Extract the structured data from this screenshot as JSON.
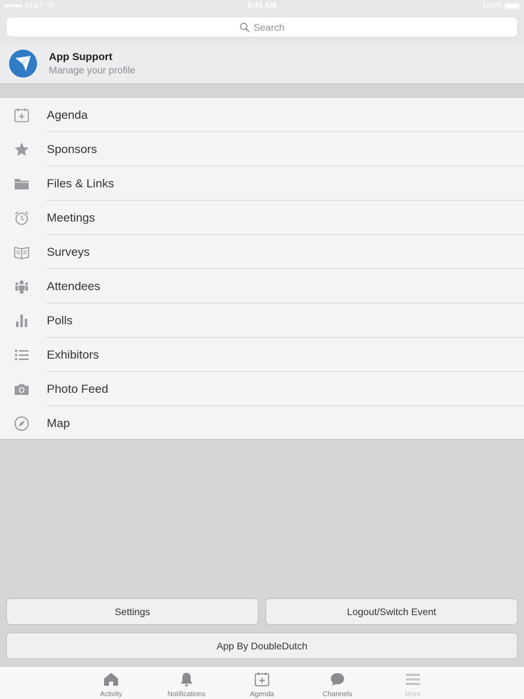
{
  "status_bar": {
    "carrier": "AT&T",
    "time": "9:41 AM",
    "battery": "100%"
  },
  "search": {
    "placeholder": "Search"
  },
  "profile": {
    "name": "App Support",
    "subtitle": "Manage your profile"
  },
  "menu": [
    {
      "label": "Agenda",
      "icon": "calendar-icon"
    },
    {
      "label": "Sponsors",
      "icon": "star-icon"
    },
    {
      "label": "Files & Links",
      "icon": "folder-icon"
    },
    {
      "label": "Meetings",
      "icon": "alarm-clock-icon"
    },
    {
      "label": "Surveys",
      "icon": "book-icon"
    },
    {
      "label": "Attendees",
      "icon": "people-icon"
    },
    {
      "label": "Polls",
      "icon": "bar-chart-icon"
    },
    {
      "label": "Exhibitors",
      "icon": "list-icon"
    },
    {
      "label": "Photo Feed",
      "icon": "camera-icon"
    },
    {
      "label": "Map",
      "icon": "compass-icon"
    }
  ],
  "buttons": {
    "settings": "Settings",
    "logout": "Logout/Switch Event",
    "app_by": "App By DoubleDutch"
  },
  "tabs": [
    {
      "label": "Activity",
      "icon": "home-icon"
    },
    {
      "label": "Notifications",
      "icon": "bell-icon"
    },
    {
      "label": "Agenda",
      "icon": "calendar-icon"
    },
    {
      "label": "Channels",
      "icon": "chat-bubble-icon"
    },
    {
      "label": "More",
      "icon": "menu-icon"
    }
  ],
  "colors": {
    "icon_gray": "#9a9a9f",
    "avatar_blue": "#2f7bc4",
    "background": "#d5d5d8"
  }
}
